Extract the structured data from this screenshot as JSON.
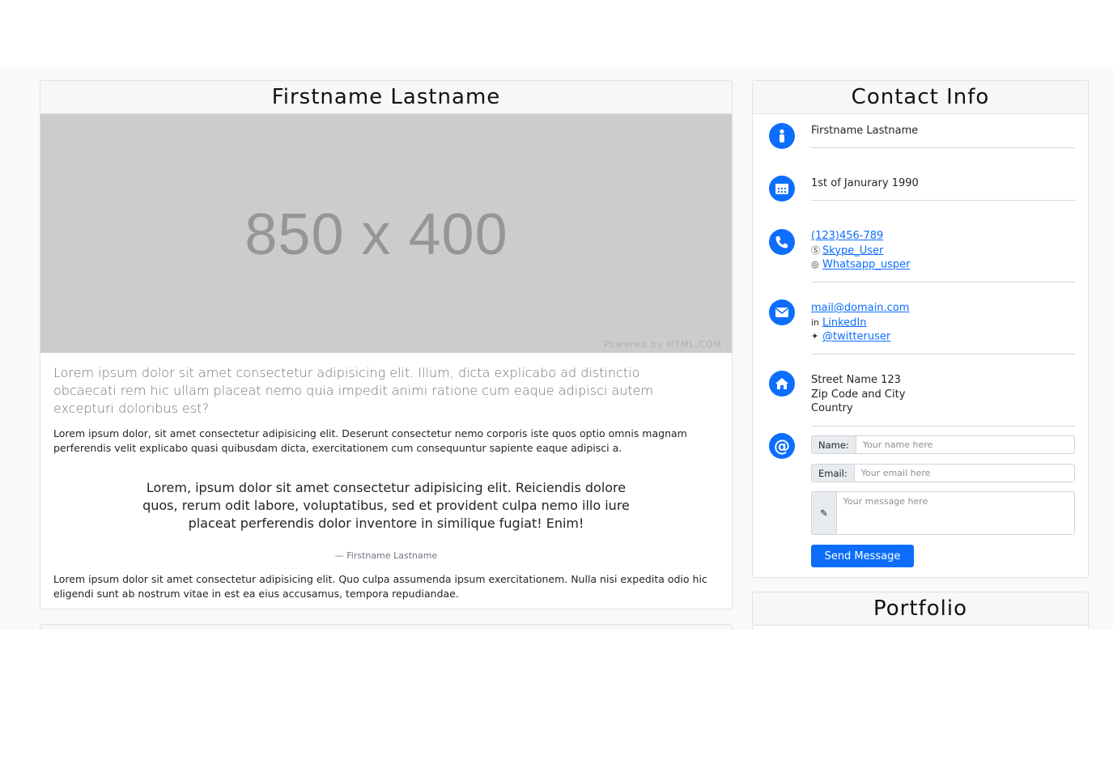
{
  "profile": {
    "title": "Firstname Lastname",
    "placeholder_text": "850 x 400",
    "placeholder_powered": "Powered by HTML.COM",
    "lead": "Lorem ipsum dolor sit amet consectetur adipisicing elit. Illum, dicta explicabo ad distinctio obcaecati rem hic ullam placeat nemo quia impedit animi ratione cum eaque adipisci autem excepturi doloribus est?",
    "paragraph_1": "Lorem ipsum dolor, sit amet consectetur adipisicing elit. Deserunt consectetur nemo corporis iste quos optio omnis magnam perferendis velit explicabo quasi quibusdam dicta, exercitationem cum consequuntur sapiente eaque adipisci a.",
    "quote": "Lorem, ipsum dolor sit amet consectetur adipisicing elit. Reiciendis dolore quos, rerum odit labore, voluptatibus, sed et provident culpa nemo illo iure placeat perferendis dolor inventore in similique fugiat! Enim!",
    "quote_author": "— Firstname Lastname",
    "paragraph_2": "Lorem ipsum dolor sit amet consectetur adipisicing elit. Quo culpa assumenda ipsum exercitationem. Nulla nisi expedita odio hic eligendi sunt ab nostrum vitae in est ea eius accusamus, tempora repudiandae."
  },
  "contact": {
    "title": "Contact Info",
    "name": "Firstname Lastname",
    "birthday": "1st of Janurary 1990",
    "phone": "(123)456-789",
    "skype": "Skype_User",
    "whatsapp": "Whatsapp_usper",
    "email": "mail@domain.com",
    "linkedin": "LinkedIn",
    "twitter": "@twitteruser",
    "address_street": "Street Name 123",
    "address_zip": "Zip Code and City",
    "address_country": "Country",
    "form": {
      "name_label": "Name:",
      "name_placeholder": "Your name here",
      "email_label": "Email:",
      "email_placeholder": "Your email here",
      "message_placeholder": "Your message here",
      "send_label": "Send Message"
    }
  },
  "portfolio": {
    "title": "Portfolio"
  },
  "icons": {
    "person": "person-icon",
    "calendar": "calendar-icon",
    "phone": "phone-icon",
    "envelope": "envelope-icon",
    "home": "home-icon",
    "at": "at-icon",
    "skype": "skype-icon",
    "whatsapp": "whatsapp-icon",
    "linkedin": "linkedin-icon",
    "twitter": "twitter-icon",
    "pencil": "pencil-icon"
  },
  "colors": {
    "accent": "#0d6efd",
    "placeholder_bg": "#cccccc",
    "page_bg": "#f8f9fa"
  }
}
